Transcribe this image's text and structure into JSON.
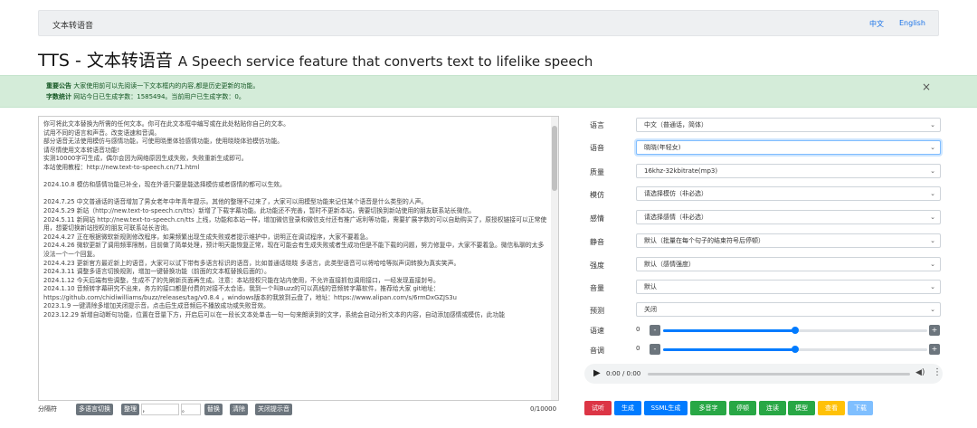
{
  "navbar": {
    "brand": "文本转语音",
    "lang_zh": "中文",
    "lang_en": "English"
  },
  "page": {
    "title": "TTS - 文本转语音",
    "subtitle": "A Speech service feature that converts text to lifelike speech"
  },
  "alert": {
    "notice_label": "重要公告",
    "notice_text": "大家使用前可以先阅读一下文本框内的内容,都是历史更新的功能。",
    "stats_label": "字数统计",
    "stats_text": "网站今日已生成字数：1585494。当前用户已生成字数：0。",
    "close": "×"
  },
  "textarea": {
    "lines": [
      "你可将此文本替换为所需的任何文本。你可在此文本框中编写或在此处粘贴你自己的文本。",
      "试用不同的语言和声音。改变语速和音调。",
      "部分语音无法使用模仿与感情功能，可使用晓墨体验感情功能，使用晓晓体验模仿功能。",
      "请尽情使用文本转语音功能!",
      "实测10000字可生成，偶尔会因为网络原因生成失败，失败重新生成即可。",
      "本站使用教程：http://new.text-to-speech.cn/71.html",
      "",
      "2024.10.8 模仿和感情功能已补全，现在外语只要是能选择模仿或者感情的都可以生效。",
      "",
      "2024.7.25 中文普通话的语音增加了男女老年中年青年提示。其他的整理不过来了，大家可以用模型功能来记住某个语音是什么类型的人声。",
      "2024.5.29 新站（http://new.text-to-speech.cn/tts）新增了下载字幕功能。此功能还不完善，暂时不更新本站，需要切换到新站使用的朋友联系站长微信。",
      "2024.5.11 新网站 http://new.text-to-speech.cn/tts 上线，功能和本站一样，增加微信登录和微信支付还有推广返利等功能，需要扩展字数的可以自助购买了，原授权链接可以正常使用，想要切换新站授权的朋友可联系站长咨询。",
      "2024.4.27 正在根据微软新规则修改程序，如果频繁出现生成失败或者提示维护中，说明正在调试程序，大家不要着急。",
      "2024.4.26 微软更新了调用频率限制，目前做了简单处理，预计明天能恢复正常，现在可能会有生成失败或者生成功但是不能下载的问题，努力修复中，大家不要着急。微信私聊的太多没法一个一个回复。",
      "2024.4.23 更新官方最近新上的语音，大家可以试下带有多语言标识的语音，比如普通话晓晓 多语言，此类型语音可以将哈哈等拟声词转换为真实笑声。",
      "2024.3.11 调整多语言切换规则，增加一键替换功能（前面的文本框替换后面的）。",
      "2024.1.12 今天后端有些调整，生成不了的先刷新页面再生成。注意：本站授权只能在站内使用，不允许直接抓包调用接口，一经发现直接封号。",
      "2024.1.10 音频转字幕研究不出来，务方的接口都是付费的对接不太合适，我到一个叫Buzz的可以高线的音频转字幕软件，推荐给大家 git地址：https://github.com/chidiwilliams/buzz/releases/tag/v0.8.4 ，windows版本的我放到云盘了，地址：https://www.alipan.com/s/6rmDxGZJS3u",
      "2023.1.9 一键清除多增加关闭提示音，点击后生成音频后不播放成功或失败音效。",
      "2023.12.29 新增自动断句功能，位置在音量下方，开启后可以在一段长文本处单击一句一句来朗读到的文字，系统会自动分析文本的内容，自动添加感情或模仿，此功能"
    ],
    "counter": "0/10000"
  },
  "bottombar": {
    "split_label": "分隔符",
    "multilang_btn": "多语言切换",
    "tidy_btn": "整理",
    "comma": "，",
    "period": "。",
    "replace_btn": "替换",
    "clear_btn": "清除",
    "close_tip_btn": "关闭提示音"
  },
  "settings": {
    "language": {
      "label": "语言",
      "value": "中文（普通话，简体）"
    },
    "voice": {
      "label": "语音",
      "value": "晓晓(年轻女)"
    },
    "quality": {
      "label": "质量",
      "value": "16khz-32kbitrate(mp3)"
    },
    "imitate": {
      "label": "模仿",
      "value": "请选择模仿（非必选）"
    },
    "emotion": {
      "label": "感情",
      "value": "请选择感情（非必选）"
    },
    "silence": {
      "label": "静音",
      "value": "默认（批量在每个句子的结束符号后停顿）"
    },
    "intensity": {
      "label": "强度",
      "value": "默认（感情强度）"
    },
    "volume": {
      "label": "音量",
      "value": "默认"
    },
    "preview": {
      "label": "预测",
      "value": "关闭"
    },
    "rate": {
      "label": "语速",
      "value": "0",
      "level": 0.5
    },
    "pitch": {
      "label": "音调",
      "value": "0",
      "level": 0.5
    }
  },
  "audio": {
    "time": "0:00 / 0:00"
  },
  "actions": [
    {
      "label": "试听",
      "color": "#dc3545"
    },
    {
      "label": "生成",
      "color": "#007bff"
    },
    {
      "label": "SSML生成",
      "color": "#007bff"
    },
    {
      "label": "多音字",
      "color": "#28a745"
    },
    {
      "label": "停顿",
      "color": "#28a745"
    },
    {
      "label": "连读",
      "color": "#28a745"
    },
    {
      "label": "模型",
      "color": "#28a745"
    },
    {
      "label": "查看",
      "color": "#ffc107"
    },
    {
      "label": "下载",
      "color": "#7fbfff"
    }
  ]
}
